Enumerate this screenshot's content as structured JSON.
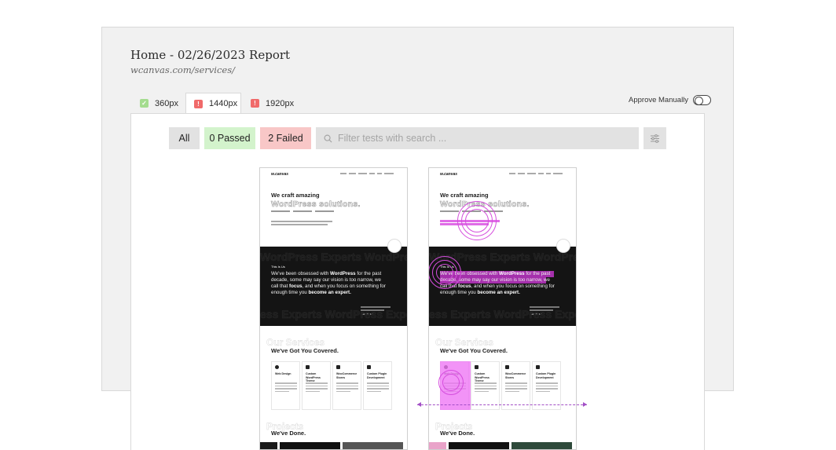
{
  "report": {
    "title": "Home - 02/26/2023 Report",
    "url": "wcanvas.com/services/"
  },
  "tabs": [
    {
      "label": "360px",
      "status": "pass",
      "icon": "check-icon",
      "active": false
    },
    {
      "label": "1440px",
      "status": "fail",
      "icon": "exclamation-icon",
      "active": true
    },
    {
      "label": "1920px",
      "status": "fail",
      "icon": "exclamation-icon",
      "active": false
    }
  ],
  "approve": {
    "label": "Approve Manually",
    "enabled": false
  },
  "filters": {
    "all": "All",
    "passed": "0 Passed",
    "failed": "2 Failed",
    "search_placeholder": "Filter tests with search ..."
  },
  "site_preview": {
    "logo": "w.canvas",
    "hero_line1": "We craft amazing",
    "hero_line2": "WordPress solutions.",
    "about_tag": "This Is Us",
    "about_text_lead": "We've been obsessed with ",
    "about_text_bold1": "WordPress",
    "about_text_mid": " for the past decade, some may say our vision is too narrow, we call that ",
    "about_text_bold2": "focus",
    "about_text_tail": ", and when you focus on something for enough time you ",
    "about_text_bold3": "become an expert.",
    "dark_ghost": "WordPress Experts WordPress",
    "dark_ghost_bottom": "ess Experts WordPress Experts",
    "covered_ghost": "Our Services",
    "covered_title": "We've Got You Covered.",
    "cards": [
      {
        "title": "Web Design"
      },
      {
        "title": "Custom WordPress Theme"
      },
      {
        "title": "WooCommerce Stores"
      },
      {
        "title": "Custom Plugin Development"
      }
    ],
    "projects_ghost": "Projects",
    "projects_title": "We've Done."
  },
  "colors": {
    "pass": "#a4dc8f",
    "fail": "#f06a6a",
    "highlight": "#d63adf",
    "dimension_line": "#a24fc6"
  }
}
